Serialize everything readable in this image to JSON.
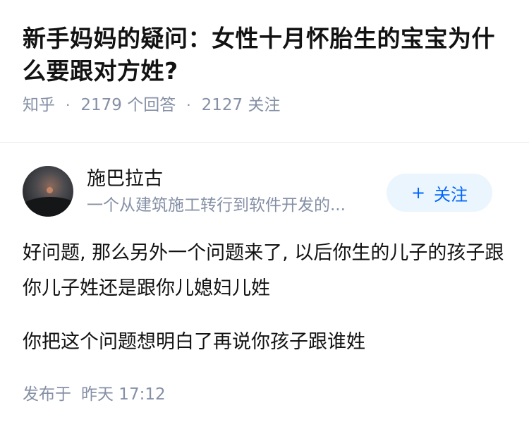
{
  "question": {
    "title": "新手妈妈的疑问：女性十月怀胎生的宝宝为什么要跟对方姓?",
    "source": "知乎",
    "separator": "·",
    "answers_count": "2179 个回答",
    "followers_count": "2127 关注"
  },
  "answer": {
    "author": {
      "name": "施巴拉古",
      "bio": "一个从建筑施工转行到软件开发的...",
      "avatar_icon": "avatar-dusk-landscape"
    },
    "follow_button": {
      "icon": "+",
      "label": "关注"
    },
    "paragraphs": [
      "好问题, 那么另外一个问题来了, 以后你生的儿子的孩子跟你儿子姓还是跟你儿媳妇儿姓",
      "你把这个问题想明白了再说你孩子跟谁姓"
    ],
    "publish": {
      "label": "发布于",
      "time": "昨天 17:12"
    }
  },
  "colors": {
    "text": "#121212",
    "meta": "#8590a6",
    "accent": "#0066ff",
    "follow_bg": "#ebf5fd",
    "divider": "#ebebeb"
  }
}
